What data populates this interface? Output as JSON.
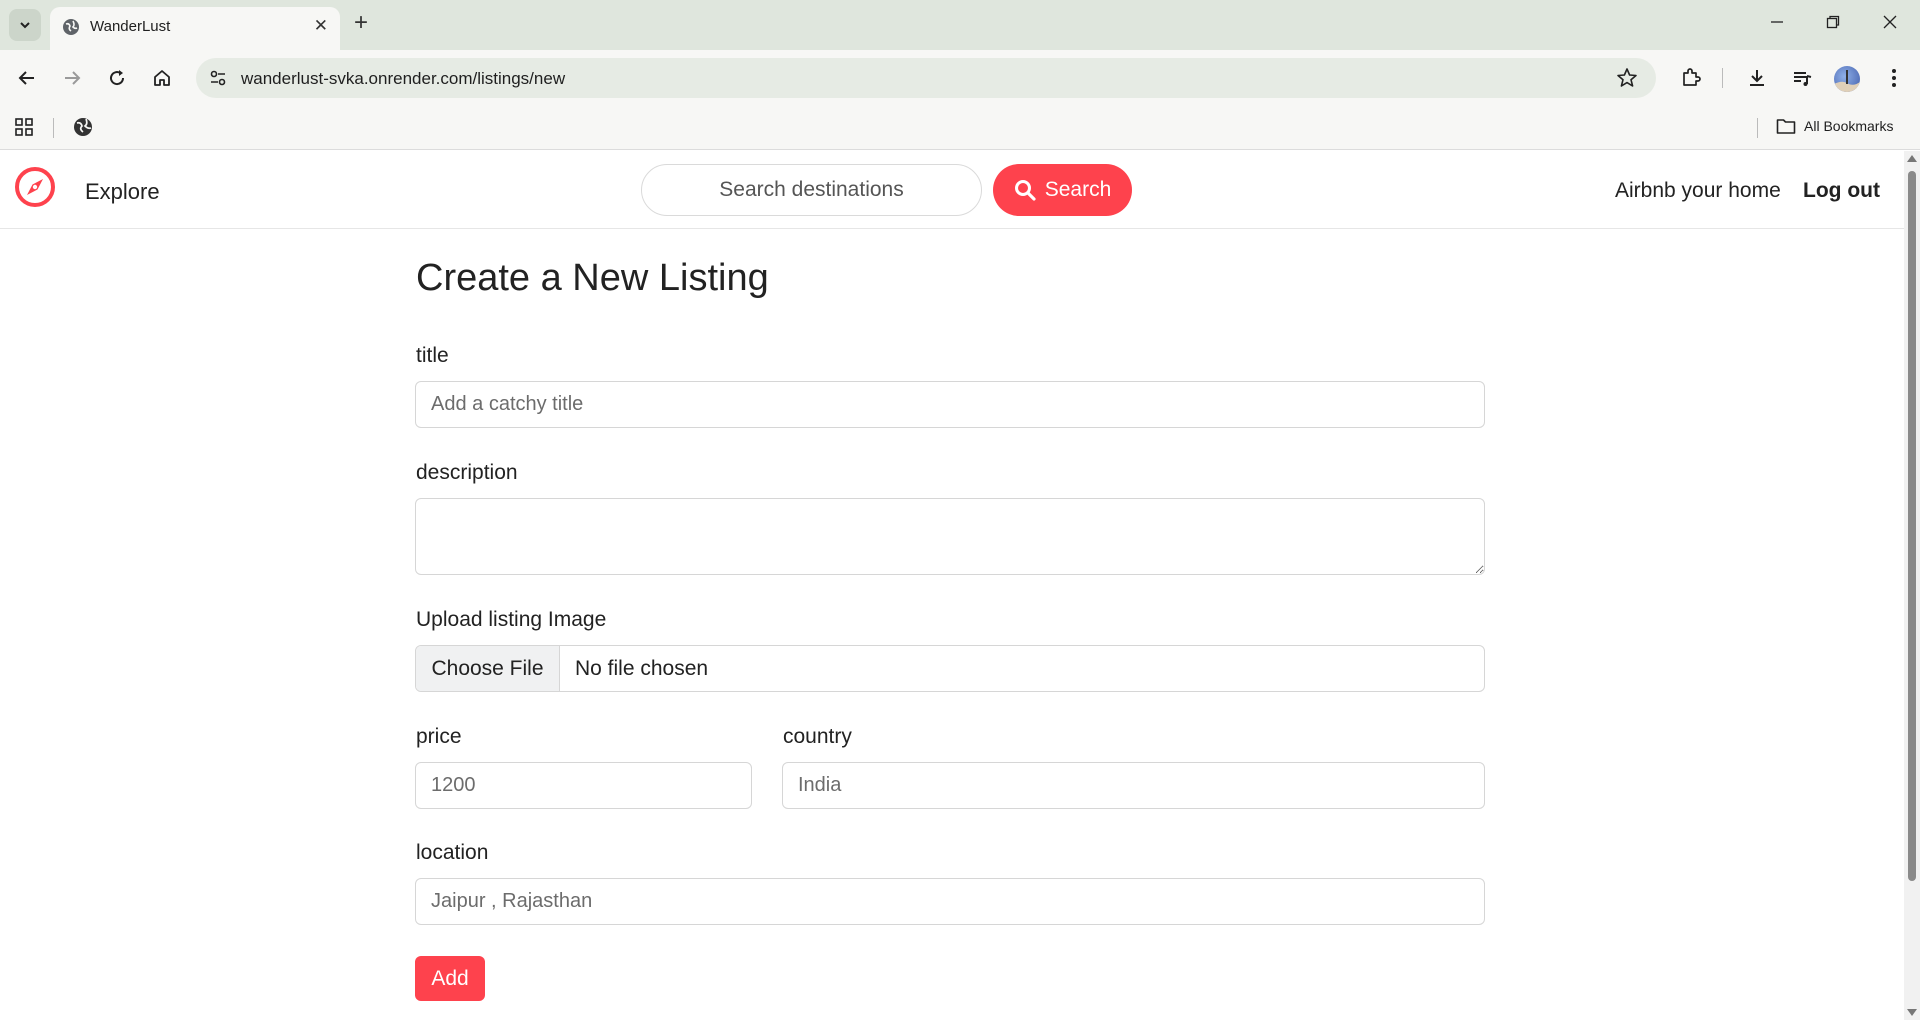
{
  "browser": {
    "tab_title": "WanderLust",
    "url": "wanderlust-svka.onrender.com/listings/new",
    "bookmarks_label": "All Bookmarks"
  },
  "nav": {
    "explore": "Explore",
    "search_placeholder": "Search destinations",
    "search_button": "Search",
    "host_link": "Airbnb your home",
    "logout": "Log out"
  },
  "form": {
    "heading": "Create a New Listing",
    "title_label": "title",
    "title_placeholder": "Add a catchy title",
    "description_label": "description",
    "image_label": "Upload listing Image",
    "file_button": "Choose File",
    "file_status": "No file chosen",
    "price_label": "price",
    "price_placeholder": "1200",
    "country_label": "country",
    "country_placeholder": "India",
    "location_label": "location",
    "location_placeholder": "Jaipur , Rajasthan",
    "submit": "Add"
  },
  "colors": {
    "brand": "#fe424d",
    "tabstrip": "#dfe6dd",
    "toolbar": "#f7f7f5"
  }
}
